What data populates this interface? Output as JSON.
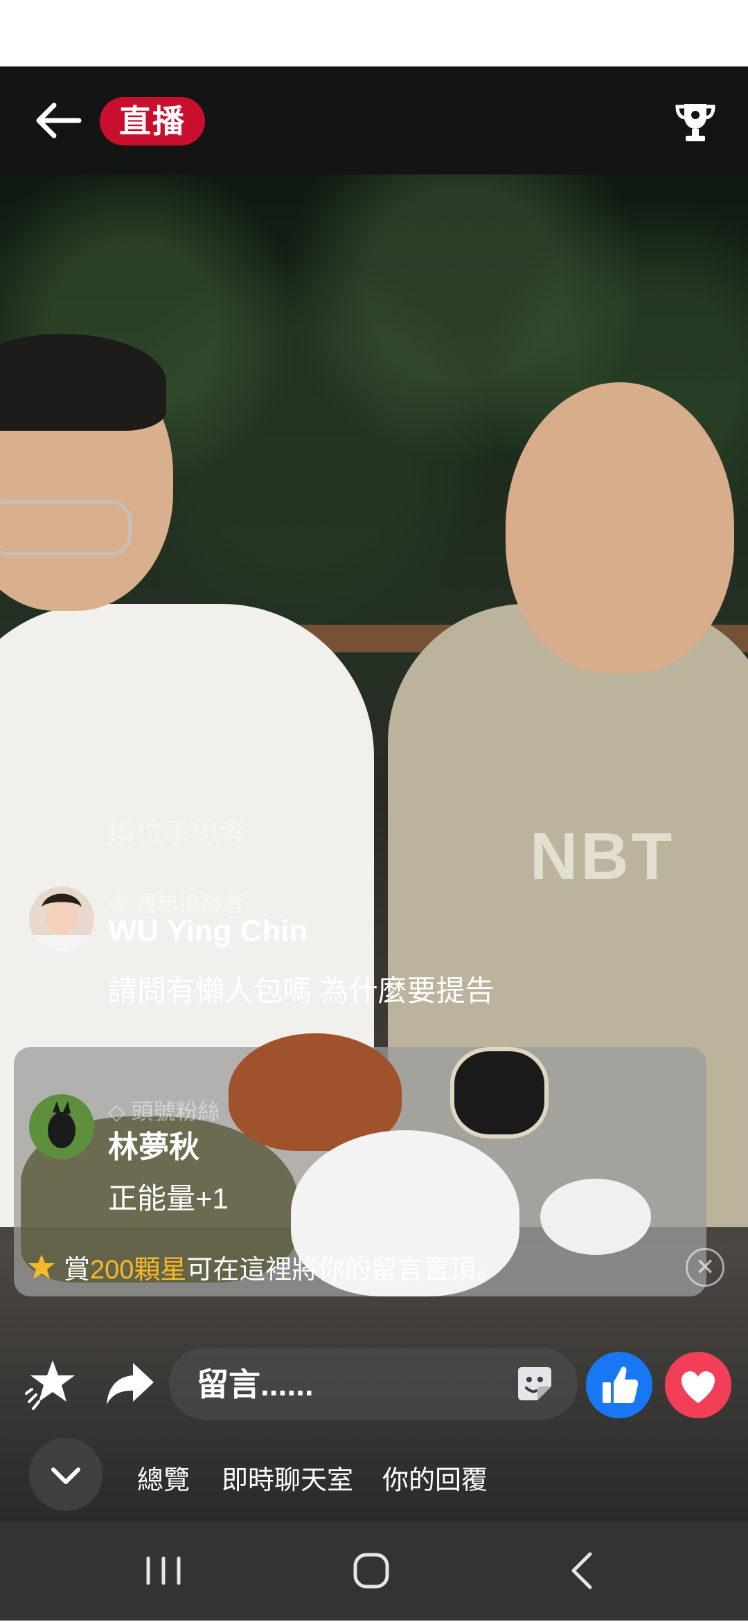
{
  "header": {
    "back_icon": "arrow-left-icon",
    "live_label": "直播",
    "trophy_icon": "trophy-icon"
  },
  "video": {
    "shirt_text": "NBT"
  },
  "comments": {
    "ghost_text": "換位子思考",
    "items": [
      {
        "badge": "週年追蹤者",
        "name": "WU Ying Chin",
        "message": "請問有懶人包嗎 為什麼要提告"
      },
      {
        "badge": "頭號粉絲",
        "name": "林夢秋",
        "message": "正能量+1"
      }
    ]
  },
  "pin_bar": {
    "prefix": "賞",
    "highlight": "200顆星",
    "suffix": "可在這裡將你的留言置頂。"
  },
  "action_row": {
    "comment_placeholder": "留言......",
    "icons": [
      "star-icon",
      "share-icon",
      "sticker-icon",
      "like-icon",
      "love-icon"
    ]
  },
  "tabs": {
    "items": [
      "總覽",
      "即時聊天室",
      "你的回覆"
    ]
  },
  "colors": {
    "live_red": "#c8102e",
    "star_gold": "#f7b928",
    "like_blue": "#1877f2",
    "love_red": "#f33e58"
  }
}
